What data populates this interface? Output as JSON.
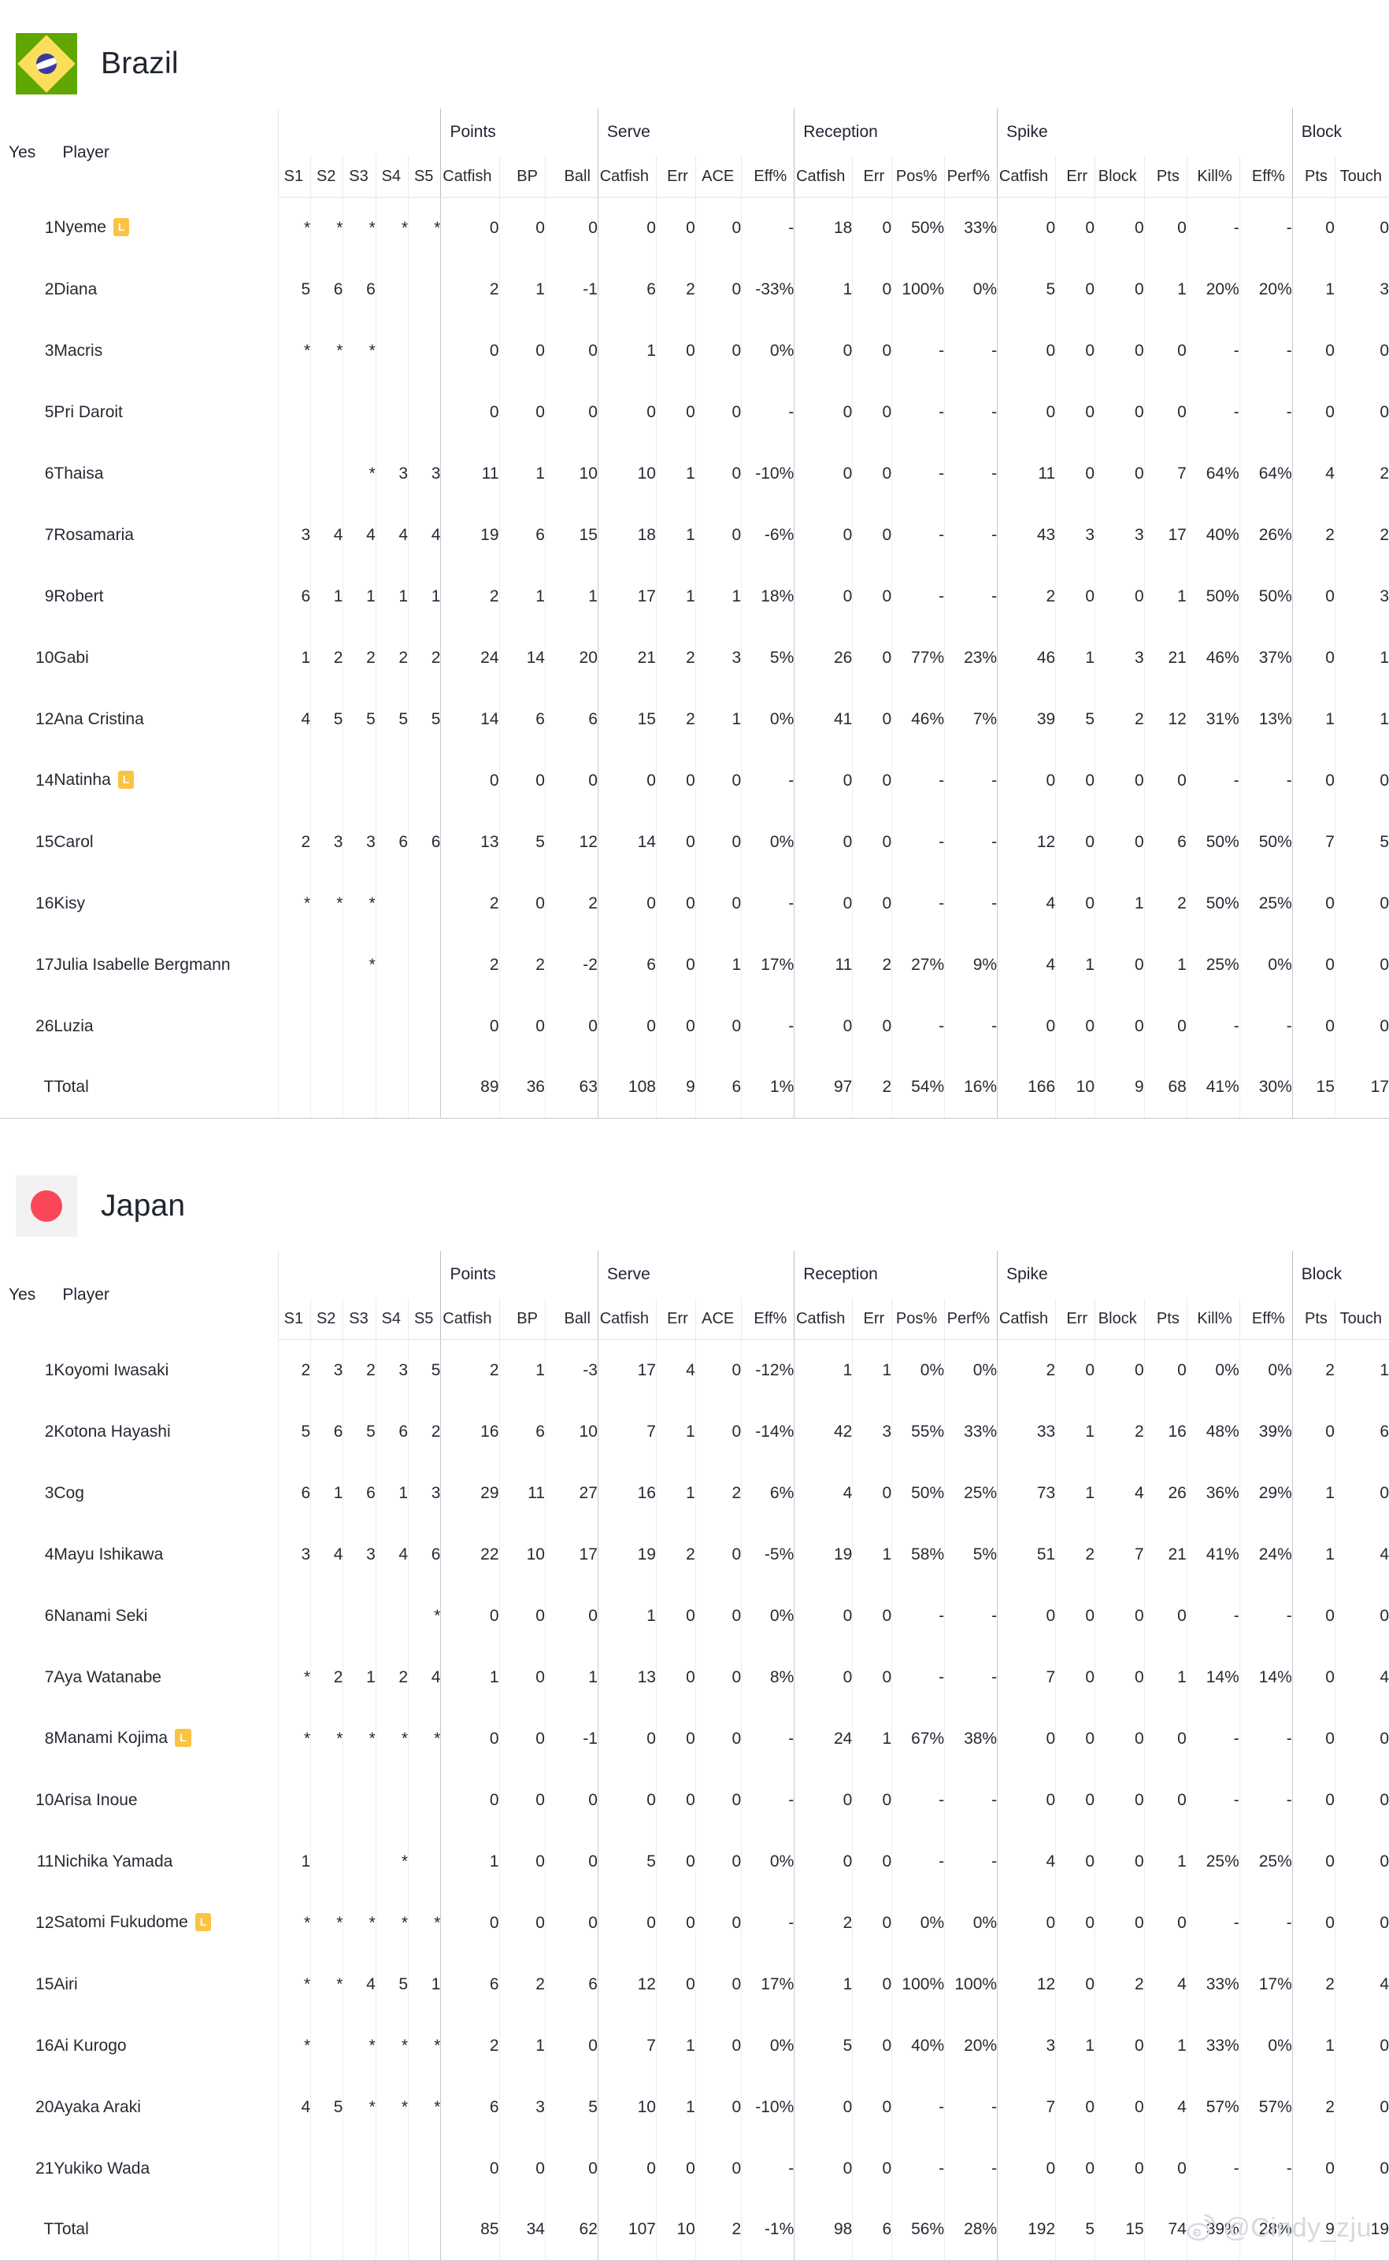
{
  "page": {
    "watermark": "@Cindy_zju"
  },
  "columns": {
    "groups": [
      {
        "label": "",
        "span": 2
      },
      {
        "label": "",
        "span": 5
      },
      {
        "label": "Points",
        "span": 3
      },
      {
        "label": "Serve",
        "span": 4
      },
      {
        "label": "Reception",
        "span": 4
      },
      {
        "label": "Spike",
        "span": 6
      },
      {
        "label": "Block",
        "span": 2
      }
    ],
    "corner": {
      "yes": "Yes",
      "player": "Player"
    },
    "sub": [
      "S1",
      "S2",
      "S3",
      "S4",
      "S5",
      "Catfish",
      "BP",
      "Ball",
      "Catfish",
      "Err",
      "ACE",
      "Eff%",
      "Catfish",
      "Err",
      "Pos%",
      "Perf%",
      "Catfish",
      "Err",
      "Block",
      "Pts",
      "Kill%",
      "Eff%",
      "Pts",
      "Touch"
    ]
  },
  "teams": [
    {
      "name": "Brazil",
      "flag": "brazil-flag",
      "rows": [
        {
          "no": "1",
          "player": "Nyeme",
          "libero": "L",
          "cells": [
            "*",
            "*",
            "*",
            "*",
            "*",
            "0",
            "0",
            "0",
            "0",
            "0",
            "0",
            "-",
            "18",
            "0",
            "50%",
            "33%",
            "0",
            "0",
            "0",
            "0",
            "-",
            "-",
            "0",
            "0"
          ]
        },
        {
          "no": "2",
          "player": "Diana",
          "libero": "",
          "cells": [
            "5",
            "6",
            "6",
            "",
            "",
            "2",
            "1",
            "-1",
            "6",
            "2",
            "0",
            "-33%",
            "1",
            "0",
            "100%",
            "0%",
            "5",
            "0",
            "0",
            "1",
            "20%",
            "20%",
            "1",
            "3"
          ]
        },
        {
          "no": "3",
          "player": "Macris",
          "libero": "",
          "cells": [
            "*",
            "*",
            "*",
            "",
            "",
            "0",
            "0",
            "0",
            "1",
            "0",
            "0",
            "0%",
            "0",
            "0",
            "-",
            "-",
            "0",
            "0",
            "0",
            "0",
            "-",
            "-",
            "0",
            "0"
          ]
        },
        {
          "no": "5",
          "player": "Pri Daroit",
          "libero": "",
          "cells": [
            "",
            "",
            "",
            "",
            "",
            "0",
            "0",
            "0",
            "0",
            "0",
            "0",
            "-",
            "0",
            "0",
            "-",
            "-",
            "0",
            "0",
            "0",
            "0",
            "-",
            "-",
            "0",
            "0"
          ]
        },
        {
          "no": "6",
          "player": "Thaisa",
          "libero": "",
          "cells": [
            "",
            "",
            "*",
            "3",
            "3",
            "11",
            "1",
            "10",
            "10",
            "1",
            "0",
            "-10%",
            "0",
            "0",
            "-",
            "-",
            "11",
            "0",
            "0",
            "7",
            "64%",
            "64%",
            "4",
            "2"
          ]
        },
        {
          "no": "7",
          "player": "Rosamaria",
          "libero": "",
          "cells": [
            "3",
            "4",
            "4",
            "4",
            "4",
            "19",
            "6",
            "15",
            "18",
            "1",
            "0",
            "-6%",
            "0",
            "0",
            "-",
            "-",
            "43",
            "3",
            "3",
            "17",
            "40%",
            "26%",
            "2",
            "2"
          ]
        },
        {
          "no": "9",
          "player": "Robert",
          "libero": "",
          "cells": [
            "6",
            "1",
            "1",
            "1",
            "1",
            "2",
            "1",
            "1",
            "17",
            "1",
            "1",
            "18%",
            "0",
            "0",
            "-",
            "-",
            "2",
            "0",
            "0",
            "1",
            "50%",
            "50%",
            "0",
            "3"
          ]
        },
        {
          "no": "10",
          "player": "Gabi",
          "libero": "",
          "cells": [
            "1",
            "2",
            "2",
            "2",
            "2",
            "24",
            "14",
            "20",
            "21",
            "2",
            "3",
            "5%",
            "26",
            "0",
            "77%",
            "23%",
            "46",
            "1",
            "3",
            "21",
            "46%",
            "37%",
            "0",
            "1"
          ]
        },
        {
          "no": "12",
          "player": "Ana Cristina",
          "libero": "",
          "cells": [
            "4",
            "5",
            "5",
            "5",
            "5",
            "14",
            "6",
            "6",
            "15",
            "2",
            "1",
            "0%",
            "41",
            "0",
            "46%",
            "7%",
            "39",
            "5",
            "2",
            "12",
            "31%",
            "13%",
            "1",
            "1"
          ]
        },
        {
          "no": "14",
          "player": "Natinha",
          "libero": "L",
          "cells": [
            "",
            "",
            "",
            "",
            "",
            "0",
            "0",
            "0",
            "0",
            "0",
            "0",
            "-",
            "0",
            "0",
            "-",
            "-",
            "0",
            "0",
            "0",
            "0",
            "-",
            "-",
            "0",
            "0"
          ]
        },
        {
          "no": "15",
          "player": "Carol",
          "libero": "",
          "cells": [
            "2",
            "3",
            "3",
            "6",
            "6",
            "13",
            "5",
            "12",
            "14",
            "0",
            "0",
            "0%",
            "0",
            "0",
            "-",
            "-",
            "12",
            "0",
            "0",
            "6",
            "50%",
            "50%",
            "7",
            "5"
          ]
        },
        {
          "no": "16",
          "player": "Kisy",
          "libero": "",
          "cells": [
            "*",
            "*",
            "*",
            "",
            "",
            "2",
            "0",
            "2",
            "0",
            "0",
            "0",
            "-",
            "0",
            "0",
            "-",
            "-",
            "4",
            "0",
            "1",
            "2",
            "50%",
            "25%",
            "0",
            "0"
          ]
        },
        {
          "no": "17",
          "player": "Julia Isabelle Bergmann",
          "libero": "",
          "cells": [
            "",
            "",
            "*",
            "",
            "",
            "2",
            "2",
            "-2",
            "6",
            "0",
            "1",
            "17%",
            "11",
            "2",
            "27%",
            "9%",
            "4",
            "1",
            "0",
            "1",
            "25%",
            "0%",
            "0",
            "0"
          ]
        },
        {
          "no": "26",
          "player": "Luzia",
          "libero": "",
          "cells": [
            "",
            "",
            "",
            "",
            "",
            "0",
            "0",
            "0",
            "0",
            "0",
            "0",
            "-",
            "0",
            "0",
            "-",
            "-",
            "0",
            "0",
            "0",
            "0",
            "-",
            "-",
            "0",
            "0"
          ]
        },
        {
          "no": "T",
          "player": "Total",
          "libero": "",
          "total": true,
          "cells": [
            "",
            "",
            "",
            "",
            "",
            "89",
            "36",
            "63",
            "108",
            "9",
            "6",
            "1%",
            "97",
            "2",
            "54%",
            "16%",
            "166",
            "10",
            "9",
            "68",
            "41%",
            "30%",
            "15",
            "17"
          ]
        }
      ]
    },
    {
      "name": "Japan",
      "flag": "japan-flag",
      "rows": [
        {
          "no": "1",
          "player": "Koyomi Iwasaki",
          "libero": "",
          "cells": [
            "2",
            "3",
            "2",
            "3",
            "5",
            "2",
            "1",
            "-3",
            "17",
            "4",
            "0",
            "-12%",
            "1",
            "1",
            "0%",
            "0%",
            "2",
            "0",
            "0",
            "0",
            "0%",
            "0%",
            "2",
            "1"
          ]
        },
        {
          "no": "2",
          "player": "Kotona Hayashi",
          "libero": "",
          "cells": [
            "5",
            "6",
            "5",
            "6",
            "2",
            "16",
            "6",
            "10",
            "7",
            "1",
            "0",
            "-14%",
            "42",
            "3",
            "55%",
            "33%",
            "33",
            "1",
            "2",
            "16",
            "48%",
            "39%",
            "0",
            "6"
          ]
        },
        {
          "no": "3",
          "player": "Cog",
          "libero": "",
          "cells": [
            "6",
            "1",
            "6",
            "1",
            "3",
            "29",
            "11",
            "27",
            "16",
            "1",
            "2",
            "6%",
            "4",
            "0",
            "50%",
            "25%",
            "73",
            "1",
            "4",
            "26",
            "36%",
            "29%",
            "1",
            "0"
          ]
        },
        {
          "no": "4",
          "player": "Mayu Ishikawa",
          "libero": "",
          "cells": [
            "3",
            "4",
            "3",
            "4",
            "6",
            "22",
            "10",
            "17",
            "19",
            "2",
            "0",
            "-5%",
            "19",
            "1",
            "58%",
            "5%",
            "51",
            "2",
            "7",
            "21",
            "41%",
            "24%",
            "1",
            "4"
          ]
        },
        {
          "no": "6",
          "player": "Nanami Seki",
          "libero": "",
          "cells": [
            "",
            "",
            "",
            "",
            "*",
            "0",
            "0",
            "0",
            "1",
            "0",
            "0",
            "0%",
            "0",
            "0",
            "-",
            "-",
            "0",
            "0",
            "0",
            "0",
            "-",
            "-",
            "0",
            "0"
          ]
        },
        {
          "no": "7",
          "player": "Aya Watanabe",
          "libero": "",
          "cells": [
            "*",
            "2",
            "1",
            "2",
            "4",
            "1",
            "0",
            "1",
            "13",
            "0",
            "0",
            "8%",
            "0",
            "0",
            "-",
            "-",
            "7",
            "0",
            "0",
            "1",
            "14%",
            "14%",
            "0",
            "4"
          ]
        },
        {
          "no": "8",
          "player": "Manami Kojima",
          "libero": "L",
          "cells": [
            "*",
            "*",
            "*",
            "*",
            "*",
            "0",
            "0",
            "-1",
            "0",
            "0",
            "0",
            "-",
            "24",
            "1",
            "67%",
            "38%",
            "0",
            "0",
            "0",
            "0",
            "-",
            "-",
            "0",
            "0"
          ]
        },
        {
          "no": "10",
          "player": "Arisa Inoue",
          "libero": "",
          "cells": [
            "",
            "",
            "",
            "",
            "",
            "0",
            "0",
            "0",
            "0",
            "0",
            "0",
            "-",
            "0",
            "0",
            "-",
            "-",
            "0",
            "0",
            "0",
            "0",
            "-",
            "-",
            "0",
            "0"
          ]
        },
        {
          "no": "11",
          "player": "Nichika Yamada",
          "libero": "",
          "cells": [
            "1",
            "",
            "",
            "*",
            "",
            "1",
            "0",
            "0",
            "5",
            "0",
            "0",
            "0%",
            "0",
            "0",
            "-",
            "-",
            "4",
            "0",
            "0",
            "1",
            "25%",
            "25%",
            "0",
            "0"
          ]
        },
        {
          "no": "12",
          "player": "Satomi Fukudome",
          "libero": "L",
          "cells": [
            "*",
            "*",
            "*",
            "*",
            "*",
            "0",
            "0",
            "0",
            "0",
            "0",
            "0",
            "-",
            "2",
            "0",
            "0%",
            "0%",
            "0",
            "0",
            "0",
            "0",
            "-",
            "-",
            "0",
            "0"
          ]
        },
        {
          "no": "15",
          "player": "Airi",
          "libero": "",
          "cells": [
            "*",
            "*",
            "4",
            "5",
            "1",
            "6",
            "2",
            "6",
            "12",
            "0",
            "0",
            "17%",
            "1",
            "0",
            "100%",
            "100%",
            "12",
            "0",
            "2",
            "4",
            "33%",
            "17%",
            "2",
            "4"
          ]
        },
        {
          "no": "16",
          "player": "Ai Kurogo",
          "libero": "",
          "cells": [
            "*",
            "",
            "*",
            "*",
            "*",
            "2",
            "1",
            "0",
            "7",
            "1",
            "0",
            "0%",
            "5",
            "0",
            "40%",
            "20%",
            "3",
            "1",
            "0",
            "1",
            "33%",
            "0%",
            "1",
            "0"
          ]
        },
        {
          "no": "20",
          "player": "Ayaka Araki",
          "libero": "",
          "cells": [
            "4",
            "5",
            "*",
            "*",
            "*",
            "6",
            "3",
            "5",
            "10",
            "1",
            "0",
            "-10%",
            "0",
            "0",
            "-",
            "-",
            "7",
            "0",
            "0",
            "4",
            "57%",
            "57%",
            "2",
            "0"
          ]
        },
        {
          "no": "21",
          "player": "Yukiko Wada",
          "libero": "",
          "cells": [
            "",
            "",
            "",
            "",
            "",
            "0",
            "0",
            "0",
            "0",
            "0",
            "0",
            "-",
            "0",
            "0",
            "-",
            "-",
            "0",
            "0",
            "0",
            "0",
            "-",
            "-",
            "0",
            "0"
          ]
        },
        {
          "no": "T",
          "player": "Total",
          "libero": "",
          "total": true,
          "cells": [
            "",
            "",
            "",
            "",
            "",
            "85",
            "34",
            "62",
            "107",
            "10",
            "2",
            "-1%",
            "98",
            "6",
            "56%",
            "28%",
            "192",
            "5",
            "15",
            "74",
            "39%",
            "28%",
            "9",
            "19"
          ]
        }
      ]
    }
  ],
  "colors": {
    "libero_badge": "#fcc244",
    "brazil_green": "#5fa700",
    "brazil_yellow": "#fbdf5b",
    "brazil_blue": "#3a3a9e",
    "japan_red": "#fa4757",
    "text": "#252a32",
    "watermark": "#d6d9dd"
  }
}
